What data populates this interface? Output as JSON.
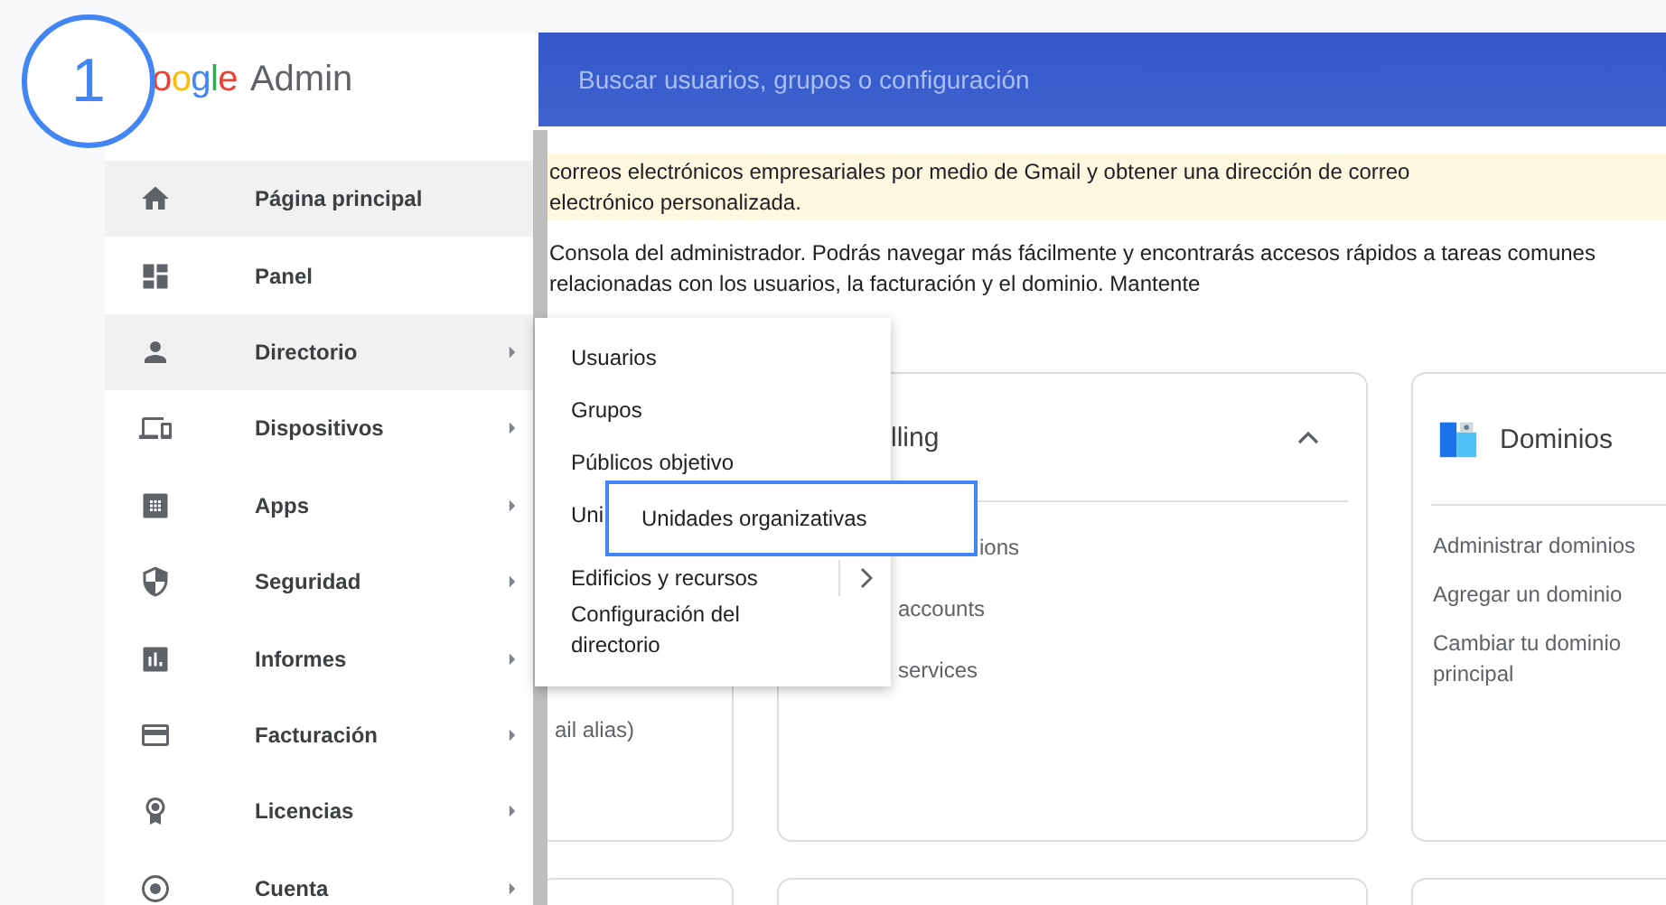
{
  "badge": "1",
  "logo": {
    "wordmark": "oogle",
    "product": "Admin"
  },
  "search": {
    "placeholder": "Buscar usuarios, grupos o configuración"
  },
  "sidebar": {
    "items": [
      {
        "label": "Página principal",
        "highlighted": true,
        "has_submenu": false
      },
      {
        "label": "Panel",
        "highlighted": false,
        "has_submenu": false
      },
      {
        "label": "Directorio",
        "highlighted": true,
        "has_submenu": true
      },
      {
        "label": "Dispositivos",
        "highlighted": false,
        "has_submenu": true
      },
      {
        "label": "Apps",
        "highlighted": false,
        "has_submenu": true
      },
      {
        "label": "Seguridad",
        "highlighted": false,
        "has_submenu": true
      },
      {
        "label": "Informes",
        "highlighted": false,
        "has_submenu": true
      },
      {
        "label": "Facturación",
        "highlighted": false,
        "has_submenu": true
      },
      {
        "label": "Licencias",
        "highlighted": false,
        "has_submenu": true
      },
      {
        "label": "Cuenta",
        "highlighted": false,
        "has_submenu": true
      }
    ]
  },
  "banner": {
    "lines": [
      "correos electrónicos empresariales por medio de Gmail y obtener una dirección de correo",
      "electrónico personalizada."
    ]
  },
  "intro": {
    "lines": [
      "Consola del administrador. Podrás navegar más fácilmente y encontrarás accesos rápidos a tareas comunes",
      "relacionadas con los usuarios, la facturación y el dominio. Mantente"
    ]
  },
  "cards": [
    {
      "kind": "partial",
      "text": "ail alias)"
    },
    {
      "kind": "collapsible",
      "title": "lling",
      "expanded": true,
      "items": [
        "ions",
        "accounts",
        "services"
      ]
    },
    {
      "kind": "domains",
      "title": "Dominios",
      "items": [
        "Administrar dominios",
        "Agregar un dominio",
        "Cambiar tu dominio principal"
      ]
    }
  ],
  "menu": {
    "items": [
      {
        "label": "Usuarios",
        "has_submenu": false
      },
      {
        "label": "Grupos",
        "has_submenu": false
      },
      {
        "label": "Públicos objetivo",
        "has_submenu": false
      },
      {
        "label": "Uni",
        "has_submenu": false
      },
      {
        "label": "Edificios y recursos",
        "has_submenu": true
      },
      {
        "label": "Configuración del directorio",
        "has_submenu": false
      }
    ]
  },
  "callout": {
    "label": "Unidades organizativas"
  }
}
